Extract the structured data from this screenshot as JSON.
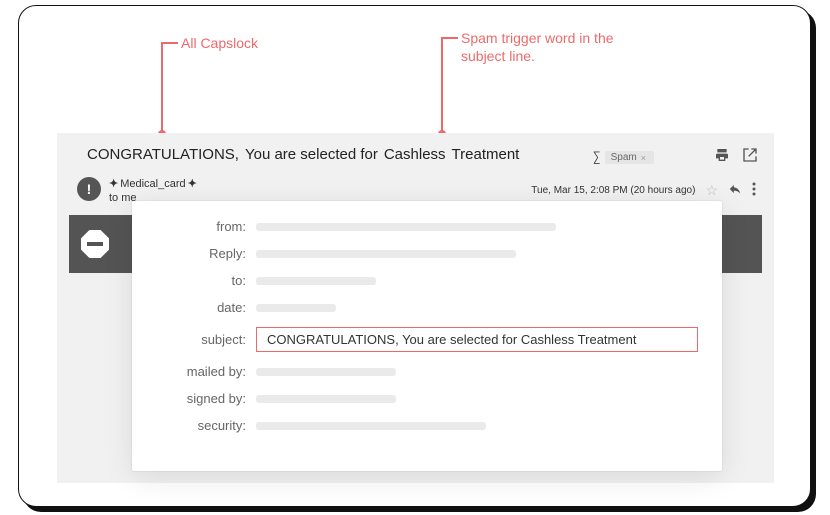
{
  "annotations": {
    "left_label": "All Capslock",
    "right_label": "Spam trigger word in the subject line."
  },
  "email": {
    "subject_prefix": "CONGRATULATIONS,",
    "subject_mid": "You are selected for",
    "subject_highlight": "Cashless",
    "subject_suffix": "Treatment",
    "spam_label": "Spam",
    "sender_name": "Medical_card",
    "recipient_line": "to me",
    "timestamp": "Tue, Mar 15, 2:08 PM (20 hours ago)"
  },
  "headers": {
    "from": "from:",
    "reply": "Reply:",
    "to": "to:",
    "date": "date:",
    "subject": "subject:",
    "mailed_by": "mailed by:",
    "signed_by": "signed by:",
    "security": "security:",
    "subject_value": "CONGRATULATIONS, You are selected for Cashless Treatment"
  }
}
